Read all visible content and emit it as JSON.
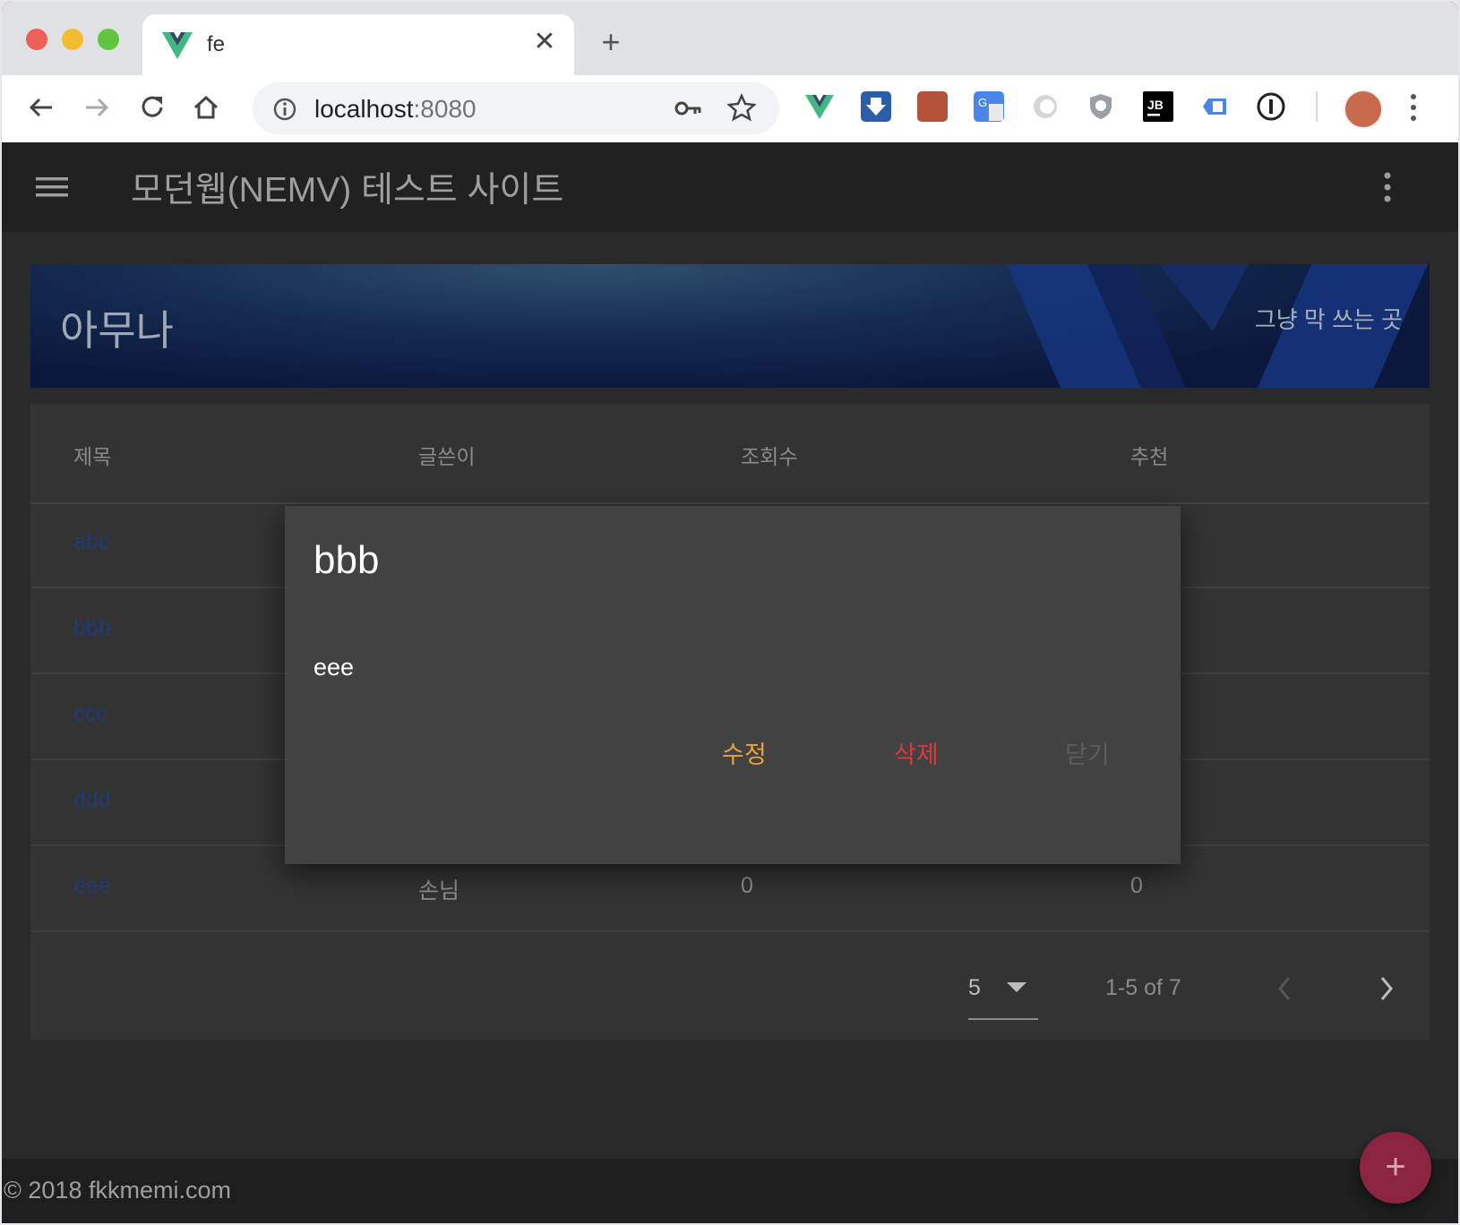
{
  "browser": {
    "tab_title": "fe",
    "close_symbol": "✕",
    "newtab_symbol": "+",
    "url_host": "localhost",
    "url_port": ":8080",
    "extensions": [
      "vue-devtools-icon",
      "download-icon",
      "pdf-icon",
      "translate-icon",
      "ring-icon",
      "shield-icon",
      "jetbrains-icon",
      "code-icon",
      "password-manager-icon"
    ]
  },
  "app": {
    "title": "모던웹(NEMV) 테스트 사이트"
  },
  "hero": {
    "title": "아무나",
    "subtitle": "그냥 막 쓰는 곳"
  },
  "table": {
    "headers": [
      "제목",
      "글쓴이",
      "조회수",
      "추천"
    ],
    "rows": [
      {
        "title": "abc"
      },
      {
        "title": "bbb"
      },
      {
        "title": "ccc"
      },
      {
        "title": "ddd"
      },
      {
        "title": "eee",
        "author": "손님",
        "views": "0",
        "likes": "0"
      }
    ]
  },
  "pagination": {
    "per_page": "5",
    "info": "1-5 of 7"
  },
  "dialog": {
    "title": "bbb",
    "content": "eee",
    "edit_label": "수정",
    "delete_label": "삭제",
    "close_label": "닫기"
  },
  "footer": {
    "text": "© 2018 fkkmemi.com"
  },
  "fab": {
    "symbol": "+"
  },
  "colors": {
    "app_bar": "#212121",
    "card": "#333333",
    "dialog": "#424242",
    "edit": "#e6a23c",
    "delete": "#e0383a",
    "fab": "#8a2440",
    "link": "#1e3b7a"
  }
}
